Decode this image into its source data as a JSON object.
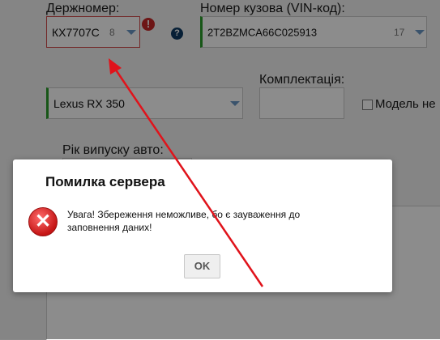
{
  "form": {
    "plate_label": "Держномер:",
    "plate_value": "КХ7707С",
    "plate_counter": "8",
    "vin_label": "Номер кузова (VIN-код):",
    "vin_value": "2T2BZMCA66C025913",
    "vin_counter": "17",
    "model_value": "Lexus RX 350",
    "equipment_label": "Комплектація:",
    "model_checkbox_label": "Модель не",
    "year_label": "Рік випуску авто:",
    "error_icon_glyph": "!",
    "help_icon_glyph": "?"
  },
  "dialog": {
    "title": "Помилка сервера",
    "message": "Увага! Збереження неможливе, бо є зауваження до заповнення даних!",
    "ok_label": "OK",
    "icon": "error-x-icon",
    "icon_glyph": "✕"
  },
  "colors": {
    "annotation_arrow": "#e0131b",
    "invalid_border": "#d24a4a",
    "valid_border": "#2a9d2a",
    "error_red": "#c62828"
  }
}
